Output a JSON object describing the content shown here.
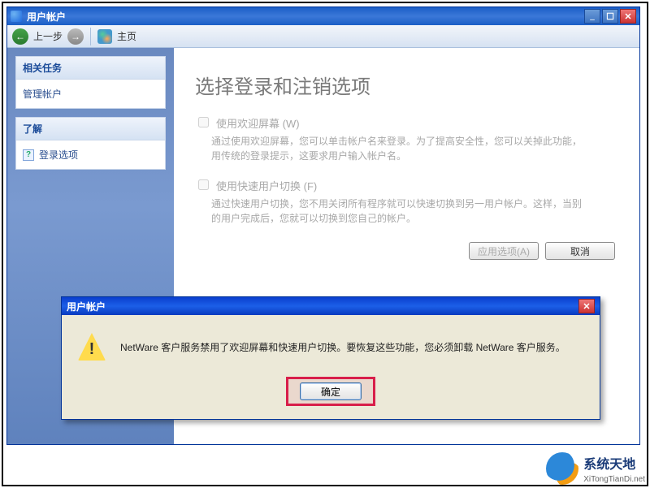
{
  "window": {
    "title": "用户帐户"
  },
  "toolbar": {
    "back_label": "上一步",
    "home_label": "主页"
  },
  "sidebar": {
    "tasks_head": "相关任务",
    "tasks_items": [
      "管理帐户"
    ],
    "learn_head": "了解",
    "learn_items": [
      "登录选项"
    ]
  },
  "main": {
    "heading": "选择登录和注销选项",
    "options": [
      {
        "title": "使用欢迎屏幕 (W)",
        "desc": "通过使用欢迎屏幕，您可以单击帐户名来登录。为了提高安全性，您可以关掉此功能，用传统的登录提示，这要求用户输入帐户名。"
      },
      {
        "title": "使用快速用户切换 (F)",
        "desc": "通过快速用户切换，您不用关闭所有程序就可以快速切换到另一用户帐户。这样，当别的用户完成后，您就可以切换到您自己的帐户。"
      }
    ],
    "apply_label": "应用选项(A)",
    "cancel_label": "取消"
  },
  "dialog": {
    "title": "用户帐户",
    "message": "NetWare 客户服务禁用了欢迎屏幕和快速用户切换。要恢复这些功能，您必须卸载 NetWare 客户服务。",
    "ok_label": "确定"
  },
  "watermark": {
    "main": "系统天地",
    "sub": "XiTongTianDi.net"
  }
}
